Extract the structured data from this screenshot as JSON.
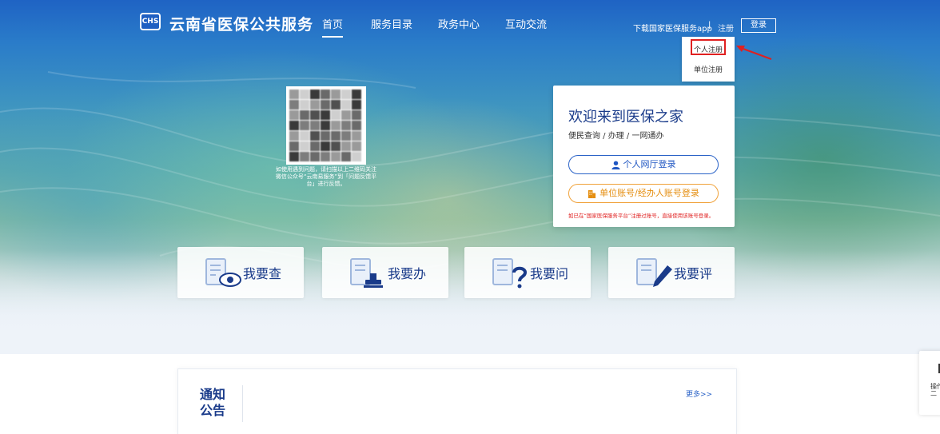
{
  "header": {
    "logo_text": "CHS",
    "title": "云南省医保公共服务",
    "nav": [
      {
        "label": "首页",
        "active": true
      },
      {
        "label": "服务目录",
        "active": false
      },
      {
        "label": "政务中心",
        "active": false
      },
      {
        "label": "互动交流",
        "active": false
      }
    ],
    "download_app": "下载国家医保服务app",
    "separator": "|",
    "register": "注册",
    "login": "登录"
  },
  "register_dropdown": {
    "items": [
      "个人注册",
      "单位注册"
    ],
    "highlighted_item": "个人注册",
    "highlight_color": "#e02020"
  },
  "qr": {
    "caption": "如使用遇到问题，请扫描以上二维码关注微信公众号“云南易服务”到「问题反馈平台」进行反馈。"
  },
  "login_card": {
    "title": "欢迎来到医保之家",
    "subtitle": "便民查询 / 办理 / 一网通办",
    "personal_login": "个人网厅登录",
    "unit_login": "单位账号/经办人账号登录",
    "note": "如已在“国家医保服务平台”注册过账号，直接使用该账号登录。",
    "accent_blue": "#2b63c7",
    "accent_orange": "#f0a23a"
  },
  "services": [
    {
      "label": "我要查",
      "icon": "search-doc-icon"
    },
    {
      "label": "我要办",
      "icon": "stamp-doc-icon"
    },
    {
      "label": "我要问",
      "icon": "question-doc-icon"
    },
    {
      "label": "我要评",
      "icon": "pen-doc-icon"
    }
  ],
  "notice": {
    "title": "通知公告",
    "more": "更多>>"
  },
  "side_float": {
    "label": "操作二"
  }
}
